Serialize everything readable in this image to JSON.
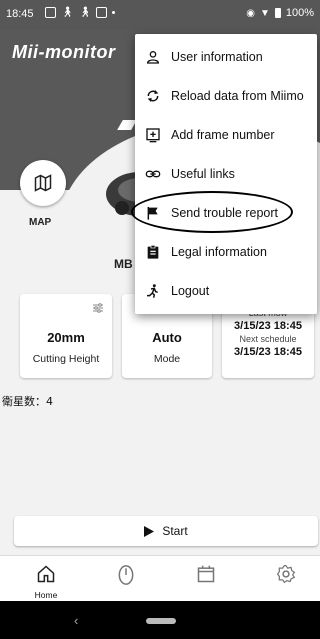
{
  "status_bar": {
    "time": "18:45",
    "battery": "100%"
  },
  "app": {
    "logo": "Mii-monitor"
  },
  "main": {
    "map_label": "MAP",
    "model_label": "MB",
    "cards": [
      {
        "value": "20mm",
        "label": "Cutting Height"
      },
      {
        "value": "Auto",
        "label": "Mode"
      }
    ],
    "schedule_card": {
      "last_label": "Last mow",
      "last_value": "3/15/23 18:45",
      "next_label": "Next schedule",
      "next_value": "3/15/23 18:45"
    },
    "satellites": "衛星数：4",
    "start_label": "Start"
  },
  "menu": {
    "items": [
      {
        "label": "User information",
        "icon": "person-icon"
      },
      {
        "label": "Reload data from Miimo",
        "icon": "refresh-icon"
      },
      {
        "label": "Add frame number",
        "icon": "add-box-icon"
      },
      {
        "label": "Useful links",
        "icon": "link-icon"
      },
      {
        "label": "Send trouble report",
        "icon": "flag-icon"
      },
      {
        "label": "Legal information",
        "icon": "clipboard-icon"
      },
      {
        "label": "Logout",
        "icon": "run-icon"
      }
    ],
    "highlighted_index": 4
  },
  "bottom_nav": {
    "items": [
      {
        "label": "Home",
        "icon": "home-icon"
      },
      {
        "label": "",
        "icon": "mower-icon"
      },
      {
        "label": "",
        "icon": "calendar-icon"
      },
      {
        "label": "",
        "icon": "gear-icon"
      }
    ]
  },
  "colors": {
    "header_bg": "#595959",
    "screen_bg": "#f2f2f2",
    "highlight_outline": "#000000"
  }
}
